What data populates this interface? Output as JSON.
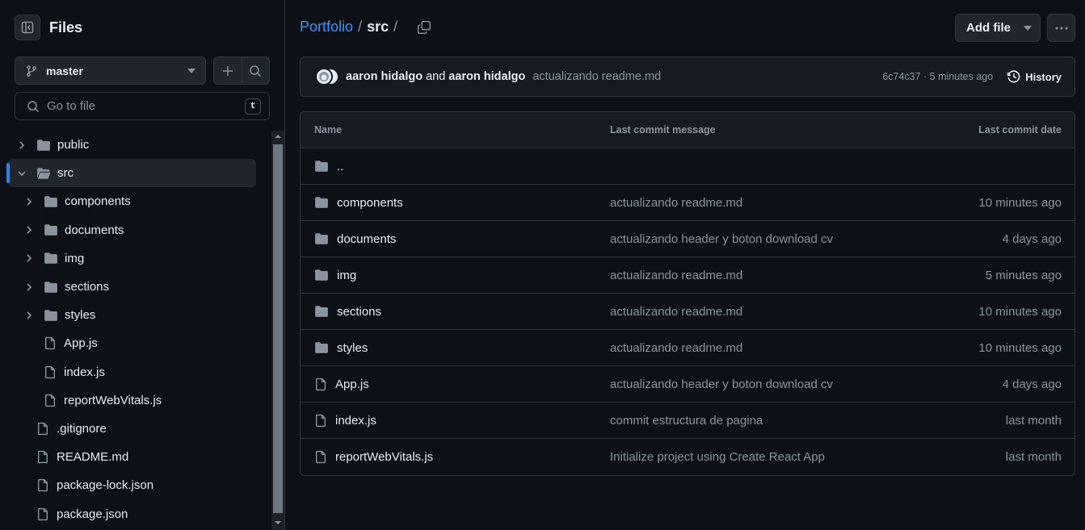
{
  "sidebar": {
    "title": "Files",
    "branch": "master",
    "goto_placeholder": "Go to file",
    "goto_shortcut": "t",
    "tree": [
      {
        "label": "public",
        "type": "folder",
        "expanded": false,
        "indent": 0
      },
      {
        "label": "src",
        "type": "folder",
        "expanded": true,
        "indent": 0,
        "selected": true
      },
      {
        "label": "components",
        "type": "folder",
        "expanded": false,
        "indent": 1
      },
      {
        "label": "documents",
        "type": "folder",
        "expanded": false,
        "indent": 1
      },
      {
        "label": "img",
        "type": "folder",
        "expanded": false,
        "indent": 1
      },
      {
        "label": "sections",
        "type": "folder",
        "expanded": false,
        "indent": 1
      },
      {
        "label": "styles",
        "type": "folder",
        "expanded": false,
        "indent": 1
      },
      {
        "label": "App.js",
        "type": "file",
        "indent": 1
      },
      {
        "label": "index.js",
        "type": "file",
        "indent": 1
      },
      {
        "label": "reportWebVitals.js",
        "type": "file",
        "indent": 1
      },
      {
        "label": ".gitignore",
        "type": "file",
        "indent": 0
      },
      {
        "label": "README.md",
        "type": "file",
        "indent": 0
      },
      {
        "label": "package-lock.json",
        "type": "file",
        "indent": 0
      },
      {
        "label": "package.json",
        "type": "file",
        "indent": 0
      }
    ]
  },
  "breadcrumb": {
    "repo": "Portfolio",
    "sep": "/",
    "current": "src",
    "trail": "/"
  },
  "toolbar": {
    "add_file": "Add file"
  },
  "commit": {
    "author1": "aaron hidalgo",
    "and": "and",
    "author2": "aaron hidalgo",
    "message": "actualizando readme.md",
    "meta": "6c74c37 · 5 minutes ago",
    "history": "History"
  },
  "table": {
    "headers": {
      "name": "Name",
      "message": "Last commit message",
      "date": "Last commit date"
    },
    "parent": "..",
    "rows": [
      {
        "name": "components",
        "type": "folder",
        "message": "actualizando readme.md",
        "date": "10 minutes ago"
      },
      {
        "name": "documents",
        "type": "folder",
        "message": "actualizando header y boton download cv",
        "date": "4 days ago"
      },
      {
        "name": "img",
        "type": "folder",
        "message": "actualizando readme.md",
        "date": "5 minutes ago"
      },
      {
        "name": "sections",
        "type": "folder",
        "message": "actualizando readme.md",
        "date": "10 minutes ago"
      },
      {
        "name": "styles",
        "type": "folder",
        "message": "actualizando readme.md",
        "date": "10 minutes ago"
      },
      {
        "name": "App.js",
        "type": "file",
        "message": "actualizando header y boton download cv",
        "date": "4 days ago"
      },
      {
        "name": "index.js",
        "type": "file",
        "message": "commit estructura de pagina",
        "date": "last month"
      },
      {
        "name": "reportWebVitals.js",
        "type": "file",
        "message": "Initialize project using Create React App",
        "date": "last month"
      }
    ]
  },
  "colors": {
    "background": "#0d1117",
    "link": "#4493f8",
    "selection": "#2f81f7",
    "muted": "#8b949e"
  },
  "icons": [
    "sidebar-collapse-icon",
    "branch-icon",
    "caret-down-icon",
    "plus-icon",
    "search-icon",
    "chevron-right-icon",
    "chevron-down-icon",
    "folder-icon",
    "file-icon",
    "copy-icon",
    "kebab-icon",
    "history-icon"
  ]
}
